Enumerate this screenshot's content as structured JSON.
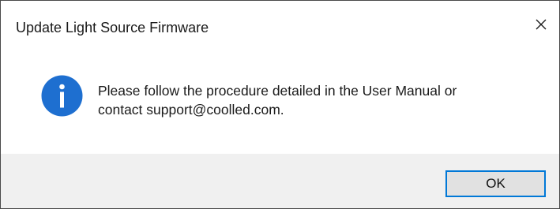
{
  "window": {
    "title": "Update Light Source Firmware",
    "close_icon": "close-icon"
  },
  "message": {
    "icon": "info-icon",
    "icon_color": "#1e6fd0",
    "line1": "Please follow the procedure detailed in the User Manual or",
    "line2": "contact support@coolled.com."
  },
  "buttons": {
    "ok_label": "OK",
    "accent_color": "#0078d7"
  }
}
